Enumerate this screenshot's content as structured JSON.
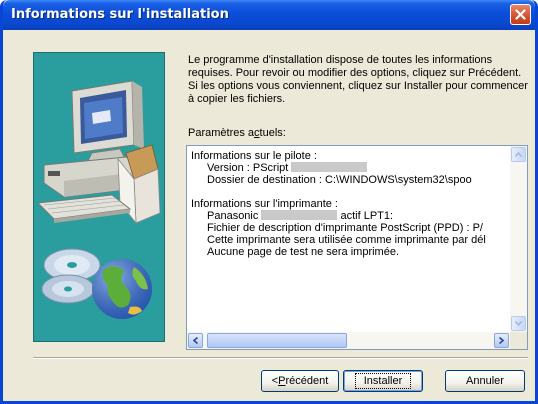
{
  "window": {
    "title": "Informations sur l'installation"
  },
  "intro_text": "Le programme d'installation dispose de toutes les informations requises. Pour revoir ou modifier des options, cliquez sur Précédent. Si les options vous conviennent, cliquez sur Installer pour commencer à copier les fichiers.",
  "params": {
    "label_prefix": "Paramètres a",
    "label_access": "c",
    "label_suffix": "tuels:"
  },
  "list": {
    "driver_header": "Informations sur le pilote :",
    "version_label": "Version : PScript",
    "destination": "Dossier de destination : C:\\WINDOWS\\system32\\spoo",
    "printer_header": "Informations sur l'imprimante :",
    "printer_name_prefix": "Panasonic",
    "printer_port": "actif LPT1:",
    "ppd_file": "Fichier de description d'imprimante PostScript (PPD) : P/",
    "default_printer": "Cette imprimante sera utilisée comme imprimante par dél",
    "test_page": "Aucune page de test ne sera imprimée."
  },
  "buttons": {
    "back_prefix": "< ",
    "back_access": "P",
    "back_suffix": "récédent",
    "install": "Installer",
    "cancel": "Annuler"
  },
  "icons": [
    "close-icon",
    "computer-illustration",
    "cd-icon",
    "globe-icon",
    "scroll-up-icon",
    "scroll-down-icon",
    "scroll-left-icon",
    "scroll-right-icon"
  ]
}
